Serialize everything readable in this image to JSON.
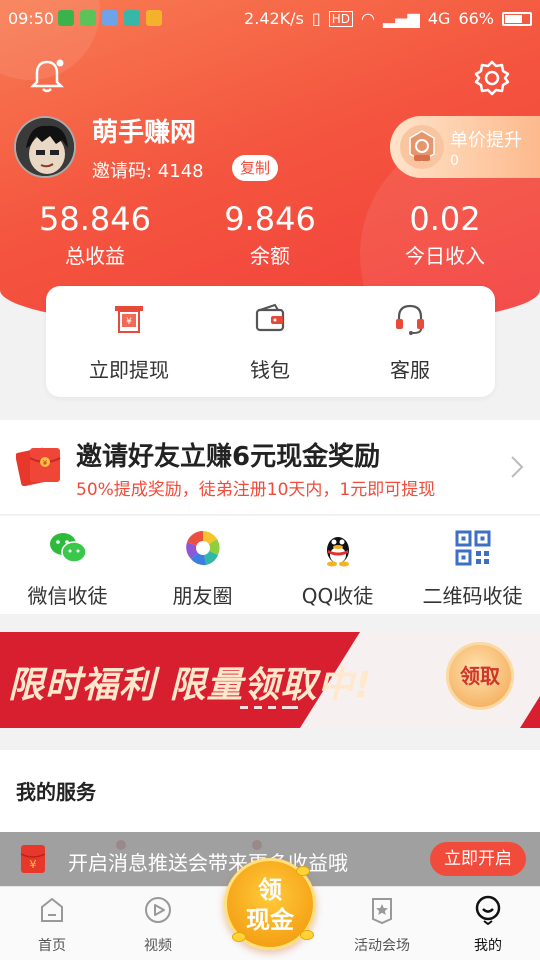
{
  "status_bar": {
    "time": "09:50",
    "speed": "2.42K/s",
    "network": "4G",
    "battery": "66%"
  },
  "header": {
    "username": "萌手赚网",
    "invite_code": "邀请码: 4148",
    "copy_label": "复制",
    "price_card": {
      "title": "单价提升",
      "count": "0"
    },
    "stats": [
      {
        "value": "58.846",
        "label": "总收益"
      },
      {
        "value": "9.846",
        "label": "余额"
      },
      {
        "value": "0.02",
        "label": "今日收入"
      }
    ]
  },
  "quick_actions": [
    {
      "label": "立即提现",
      "icon": "withdraw-icon"
    },
    {
      "label": "钱包",
      "icon": "wallet-icon"
    },
    {
      "label": "客服",
      "icon": "headset-icon"
    }
  ],
  "invite_banner": {
    "title": "邀请好友立赚6元现金奖励",
    "subtitle": "50%提成奖励，徒弟注册10天内，1元即可提现"
  },
  "share_options": [
    {
      "label": "微信收徒",
      "icon": "wechat-icon"
    },
    {
      "label": "朋友圈",
      "icon": "moments-icon"
    },
    {
      "label": "QQ收徒",
      "icon": "qq-icon"
    },
    {
      "label": "二维码收徒",
      "icon": "qrcode-icon"
    }
  ],
  "promo": {
    "text": "限时福利 限量领取中!",
    "button": "领取"
  },
  "services": {
    "title": "我的服务"
  },
  "toast": {
    "text": "开启消息推送会带来更多收益哦",
    "button": "立即开启"
  },
  "float_button": {
    "line1": "领",
    "line2": "现金"
  },
  "bottom_nav": [
    {
      "label": "首页",
      "icon": "home-icon"
    },
    {
      "label": "视频",
      "icon": "video-icon"
    },
    {
      "label": "活动会场",
      "icon": "activity-icon"
    },
    {
      "label": "我的",
      "icon": "profile-icon",
      "active": true
    }
  ],
  "colors": {
    "primary": "#f04b3b",
    "promo_red": "#d81f2f",
    "gold": "#f5a015"
  }
}
